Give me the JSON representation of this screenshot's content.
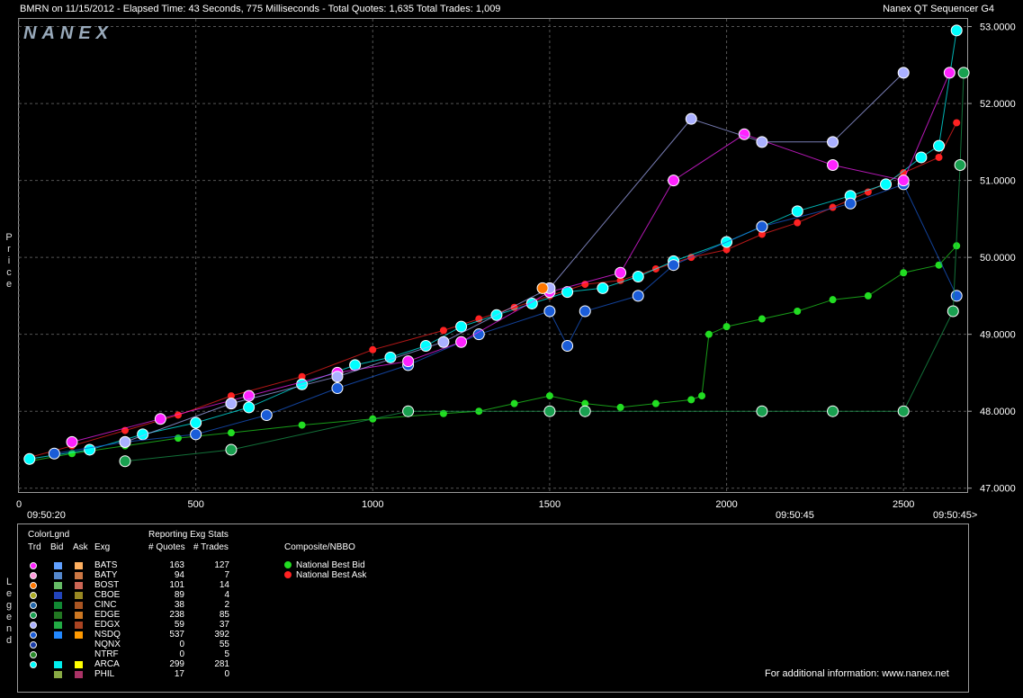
{
  "header": {
    "left": "BMRN on 11/15/2012  -  Elapsed Time: 43 Seconds, 775 Milliseconds  -  Total Quotes: 1,635  Total Trades: 1,009",
    "right": "Nanex QT Sequencer G4"
  },
  "watermark": "NANEX",
  "y_axis_title": [
    "P",
    "r",
    "i",
    "c",
    "e"
  ],
  "legend_side_title": [
    "L",
    "e",
    "g",
    "e",
    "n",
    "d"
  ],
  "x_times": {
    "start": "09:50:20",
    "mid": "09:50:45",
    "end": "09:50:45>"
  },
  "chart_data": {
    "type": "scatter",
    "xlim": [
      0,
      2680
    ],
    "ylim": [
      46.95,
      53.1
    ],
    "x_ticks": [
      0,
      500,
      1000,
      1500,
      2000,
      2500
    ],
    "y_ticks": [
      47.0,
      48.0,
      49.0,
      50.0,
      51.0,
      52.0,
      53.0
    ],
    "y_tick_labels": [
      "47.0000",
      "48.0000",
      "49.0000",
      "50.0000",
      "51.0000",
      "52.0000",
      "53.0000"
    ],
    "grid": true,
    "series": [
      {
        "name": "National Best Bid",
        "color": "#22dd22",
        "points": [
          [
            30,
            47.35
          ],
          [
            150,
            47.45
          ],
          [
            300,
            47.55
          ],
          [
            450,
            47.65
          ],
          [
            600,
            47.72
          ],
          [
            800,
            47.82
          ],
          [
            1000,
            47.9
          ],
          [
            1200,
            47.97
          ],
          [
            1300,
            48.0
          ],
          [
            1400,
            48.1
          ],
          [
            1500,
            48.2
          ],
          [
            1600,
            48.1
          ],
          [
            1700,
            48.05
          ],
          [
            1800,
            48.1
          ],
          [
            1900,
            48.15
          ],
          [
            1930,
            48.2
          ],
          [
            1950,
            49.0
          ],
          [
            2000,
            49.1
          ],
          [
            2100,
            49.2
          ],
          [
            2200,
            49.3
          ],
          [
            2300,
            49.45
          ],
          [
            2400,
            49.5
          ],
          [
            2500,
            49.8
          ],
          [
            2600,
            49.9
          ],
          [
            2650,
            50.15
          ]
        ]
      },
      {
        "name": "National Best Ask",
        "color": "#ff2222",
        "points": [
          [
            30,
            47.4
          ],
          [
            150,
            47.55
          ],
          [
            300,
            47.75
          ],
          [
            450,
            47.95
          ],
          [
            600,
            48.2
          ],
          [
            800,
            48.45
          ],
          [
            1000,
            48.8
          ],
          [
            1200,
            49.05
          ],
          [
            1300,
            49.2
          ],
          [
            1400,
            49.35
          ],
          [
            1500,
            49.5
          ],
          [
            1600,
            49.65
          ],
          [
            1700,
            49.7
          ],
          [
            1800,
            49.85
          ],
          [
            1900,
            50.0
          ],
          [
            2000,
            50.1
          ],
          [
            2100,
            50.3
          ],
          [
            2200,
            50.45
          ],
          [
            2300,
            50.65
          ],
          [
            2400,
            50.85
          ],
          [
            2500,
            51.1
          ],
          [
            2600,
            51.3
          ],
          [
            2650,
            51.75
          ]
        ]
      },
      {
        "name": "ARCA",
        "color": "#00ffff",
        "points": [
          [
            30,
            47.38
          ],
          [
            200,
            47.5
          ],
          [
            350,
            47.7
          ],
          [
            500,
            47.85
          ],
          [
            650,
            48.05
          ],
          [
            800,
            48.35
          ],
          [
            950,
            48.6
          ],
          [
            1050,
            48.7
          ],
          [
            1150,
            48.85
          ],
          [
            1250,
            49.1
          ],
          [
            1350,
            49.25
          ],
          [
            1450,
            49.4
          ],
          [
            1550,
            49.55
          ],
          [
            1650,
            49.6
          ],
          [
            1750,
            49.75
          ],
          [
            1850,
            49.95
          ],
          [
            2000,
            50.2
          ],
          [
            2100,
            50.4
          ],
          [
            2200,
            50.6
          ],
          [
            2350,
            50.8
          ],
          [
            2450,
            50.95
          ],
          [
            2550,
            51.3
          ],
          [
            2600,
            51.45
          ],
          [
            2650,
            52.95
          ]
        ]
      },
      {
        "name": "NSDQ",
        "color": "#1a5cd8",
        "points": [
          [
            100,
            47.45
          ],
          [
            300,
            47.6
          ],
          [
            500,
            47.7
          ],
          [
            700,
            47.95
          ],
          [
            900,
            48.3
          ],
          [
            1100,
            48.6
          ],
          [
            1300,
            49.0
          ],
          [
            1500,
            49.3
          ],
          [
            1550,
            48.85
          ],
          [
            1600,
            49.3
          ],
          [
            1750,
            49.5
          ],
          [
            1850,
            49.9
          ],
          [
            2100,
            50.4
          ],
          [
            2350,
            50.7
          ],
          [
            2500,
            50.95
          ],
          [
            2650,
            49.5
          ]
        ]
      },
      {
        "name": "BATS",
        "color": "#ff22ff",
        "points": [
          [
            150,
            47.6
          ],
          [
            400,
            47.9
          ],
          [
            650,
            48.2
          ],
          [
            900,
            48.5
          ],
          [
            1100,
            48.65
          ],
          [
            1250,
            48.9
          ],
          [
            1500,
            49.55
          ],
          [
            1700,
            49.8
          ],
          [
            1850,
            51.0
          ],
          [
            2050,
            51.6
          ],
          [
            2300,
            51.2
          ],
          [
            2500,
            51.0
          ],
          [
            2630,
            52.4
          ]
        ]
      },
      {
        "name": "EDGX",
        "color": "#aab0ff",
        "points": [
          [
            300,
            47.6
          ],
          [
            600,
            48.1
          ],
          [
            900,
            48.45
          ],
          [
            1200,
            48.9
          ],
          [
            1500,
            49.6
          ],
          [
            1900,
            51.8
          ],
          [
            2100,
            51.5
          ],
          [
            2300,
            51.5
          ],
          [
            2500,
            52.4
          ]
        ]
      },
      {
        "name": "EDGE",
        "color": "#19a050",
        "points": [
          [
            300,
            47.35
          ],
          [
            600,
            47.5
          ],
          [
            1100,
            48.0
          ],
          [
            1500,
            48.0
          ],
          [
            1600,
            48.0
          ],
          [
            2100,
            48.0
          ],
          [
            2300,
            48.0
          ],
          [
            2500,
            48.0
          ],
          [
            2640,
            49.3
          ],
          [
            2660,
            51.2
          ],
          [
            2670,
            52.4
          ]
        ]
      },
      {
        "name": "BOST",
        "color": "#ff7700",
        "points": [
          [
            1480,
            49.6
          ]
        ]
      }
    ]
  },
  "legend": {
    "color_legend": "ColorLgnd",
    "col_trd": "Trd",
    "col_bid": "Bid",
    "col_ask": "Ask",
    "col_exg": "Exg",
    "stats_title": "Reporting Exg Stats",
    "col_quotes": "# Quotes",
    "col_trades": "# Trades",
    "composite_title": "Composite/NBBO",
    "nbbo": [
      {
        "label": "National Best Bid",
        "color": "#22dd22"
      },
      {
        "label": "National Best Ask",
        "color": "#ff2222"
      }
    ],
    "rows": [
      {
        "exg": "BATS",
        "quotes": "163",
        "trades": "127",
        "trd": "#ff22ff",
        "bid": "#60a0ff",
        "ask": "#ffb060"
      },
      {
        "exg": "BATY",
        "quotes": "94",
        "trades": "7",
        "trd": "#ff99dd",
        "bid": "#5588cc",
        "ask": "#cc7744"
      },
      {
        "exg": "BOST",
        "quotes": "101",
        "trades": "14",
        "trd": "#ff7700",
        "bid": "#66bb66",
        "ask": "#cc6655"
      },
      {
        "exg": "CBOE",
        "quotes": "89",
        "trades": "4",
        "trd": "#aaaa22",
        "bid": "#2244bb",
        "ask": "#998822"
      },
      {
        "exg": "CINC",
        "quotes": "38",
        "trades": "2",
        "trd": "#2266aa",
        "bid": "#118833",
        "ask": "#aa5522"
      },
      {
        "exg": "EDGE",
        "quotes": "238",
        "trades": "85",
        "trd": "#19a050",
        "bid": "#227722",
        "ask": "#cc7722"
      },
      {
        "exg": "EDGX",
        "quotes": "59",
        "trades": "37",
        "trd": "#aab0ff",
        "bid": "#22aa44",
        "ask": "#aa4422"
      },
      {
        "exg": "NSDQ",
        "quotes": "537",
        "trades": "392",
        "trd": "#1a5cd8",
        "bid": "#2288ff",
        "ask": "#ff9900"
      },
      {
        "exg": "NQNX",
        "quotes": "0",
        "trades": "55",
        "trd": "#1a3ca8",
        "bid": "",
        "ask": ""
      },
      {
        "exg": "NTRF",
        "quotes": "0",
        "trades": "5",
        "trd": "#2a8a2a",
        "bid": "",
        "ask": ""
      },
      {
        "exg": "ARCA",
        "quotes": "299",
        "trades": "281",
        "trd": "#00ffff",
        "bid": "#00eeee",
        "ask": "#ffff00"
      },
      {
        "exg": "PHIL",
        "quotes": "17",
        "trades": "0",
        "trd": "",
        "bid": "#88aa44",
        "ask": "#aa3366"
      }
    ]
  },
  "footer": "For additional information: www.nanex.net"
}
